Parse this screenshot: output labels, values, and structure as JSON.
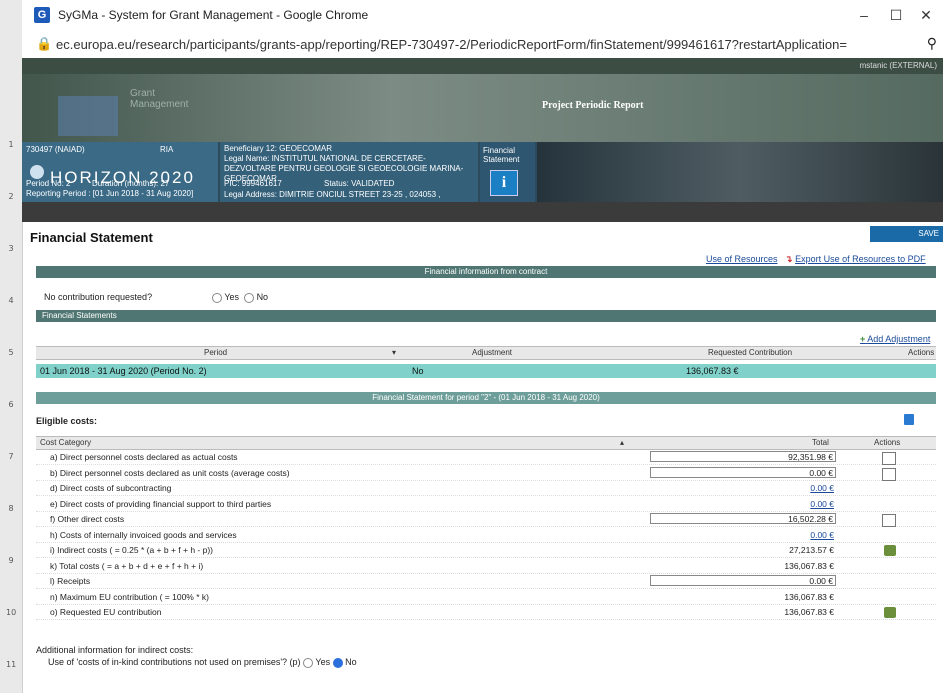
{
  "browser": {
    "title": "SyGMa - System for Grant Management - Google Chrome",
    "url": "ec.europa.eu/research/participants/grants-app/reporting/REP-730497-2/PeriodicReportForm/finStatement/999461617?restartApplication="
  },
  "ruler": [
    "1",
    "2",
    "3",
    "4",
    "5",
    "6",
    "7",
    "8",
    "9",
    "10",
    "11"
  ],
  "app": {
    "user": "mstanic (EXTERNAL)",
    "grant_mgmt": "Grant\nManagement",
    "header_title": "Project Periodic Report",
    "project_id": "730497 (NAIAD)",
    "ria": "RIA",
    "programme": "HORIZON 2020",
    "period_no": "Period No: 2",
    "duration": "Duration (months): 27",
    "reporting_period": "Reporting Period : [01 Jun 2018 - 31 Aug 2020]",
    "beneficiary": "Beneficiary 12: GEOECOMAR",
    "legal_name": "Legal Name: INSTITUTUL NATIONAL DE CERCETARE-DEZVOLTARE PENTRU GEOLOGIE SI GEOECOLOGIE MARINA-GEOECOMAR",
    "pic": "PIC: 999461617",
    "status": "Status: VALIDATED",
    "legal_address": "Legal Address: DIMITRIE ONCIUL STREET 23-25 , 024053 ,",
    "fin_statement_tab": "Financial Statement"
  },
  "page": {
    "title": "Financial Statement",
    "save_label": "SAVE",
    "use_of_resources": "Use of Resources",
    "export_pdf": "Export Use of Resources to PDF",
    "fin_info_header": "Financial information from contract",
    "no_contrib_label": "No contribution requested?",
    "yes": "Yes",
    "no": "No",
    "fin_statements_header": "Financial Statements",
    "add_adjustment": "Add Adjustment",
    "fs_table": {
      "headers": [
        "Period",
        "Adjustment",
        "Requested Contribution",
        "Actions"
      ],
      "row": {
        "period": "01 Jun 2018 - 31 Aug 2020 (Period No. 2)",
        "adjustment": "No",
        "requested": "136,067.83 €"
      }
    },
    "fs_period_header": "Financial Statement for period \"2\" - (01 Jun 2018 - 31 Aug 2020)",
    "eligible_costs": "Eligible costs:",
    "cost_table": {
      "headers": [
        "Cost Category",
        "Total",
        "Actions"
      ],
      "rows": [
        {
          "label": "a) Direct personnel costs declared as actual costs",
          "total": "92,351.98 €",
          "style": "boxed",
          "action": "edit-pencil"
        },
        {
          "label": "b) Direct personnel costs declared as unit costs (average costs)",
          "total": "0.00 €",
          "style": "boxed",
          "action": "doc"
        },
        {
          "label": "d) Direct costs of subcontracting",
          "total": "0.00 €",
          "style": "link",
          "action": ""
        },
        {
          "label": "e) Direct costs of providing financial support to third parties",
          "total": "0.00 €",
          "style": "link",
          "action": ""
        },
        {
          "label": "f) Other direct costs",
          "total": "16,502.28 €",
          "style": "boxed",
          "action": "doc"
        },
        {
          "label": "h) Costs of internally invoiced goods and services",
          "total": "0.00 €",
          "style": "link",
          "action": ""
        },
        {
          "label": "i) Indirect costs ( = 0.25 * (a + b + f + h - p))",
          "total": "27,213.57 €",
          "style": "plain",
          "action": "edit"
        },
        {
          "label": "k) Total costs ( = a + b + d + e + f + h + i)",
          "total": "136,067.83 €",
          "style": "plain",
          "action": ""
        },
        {
          "label": "l) Receipts",
          "total": "0.00 €",
          "style": "boxed",
          "action": ""
        },
        {
          "label": "n) Maximum EU contribution ( = 100% * k)",
          "total": "136,067.83 €",
          "style": "plain",
          "action": ""
        },
        {
          "label": "o) Requested EU contribution",
          "total": "136,067.83 €",
          "style": "plain",
          "action": "edit"
        }
      ]
    },
    "additional_info": "Additional information for indirect costs:",
    "inkind_question": "Use of 'costs of in-kind contributions not used on premises'? (p)",
    "inkind_yes": "Yes",
    "inkind_no": "No"
  }
}
